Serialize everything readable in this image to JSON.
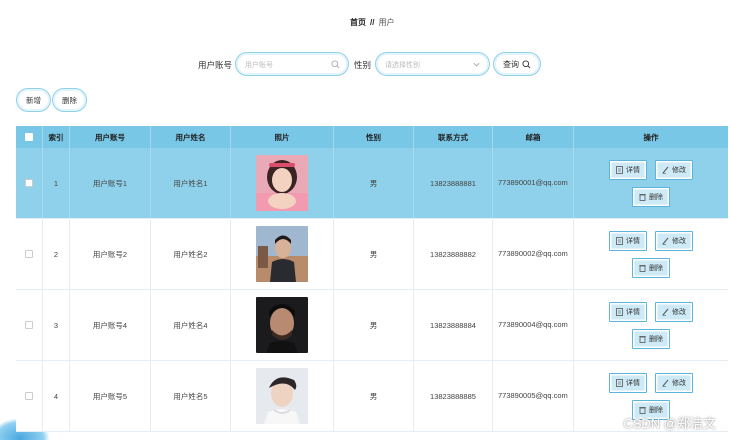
{
  "breadcrumb": {
    "home": "首页",
    "separator": "//",
    "current": "用户"
  },
  "search": {
    "account_label": "用户账号",
    "account_placeholder": "用户账号",
    "gender_label": "性别",
    "gender_placeholder": "请选择性别",
    "query_label": "查询"
  },
  "toolbar": {
    "add_label": "新增",
    "delete_label": "删除"
  },
  "table": {
    "headers": [
      "索引",
      "用户账号",
      "用户姓名",
      "照片",
      "性别",
      "联系方式",
      "邮箱",
      "操作"
    ],
    "rows": [
      {
        "index": "1",
        "account": "用户账号1",
        "name": "用户姓名1",
        "gender": "男",
        "phone": "13823888881",
        "email": "773890001@qq.com",
        "selected": true,
        "photo": "female-portrait-icon"
      },
      {
        "index": "2",
        "account": "用户账号2",
        "name": "用户姓名2",
        "gender": "男",
        "phone": "13823888882",
        "email": "773890002@qq.com",
        "selected": false,
        "photo": "male-street-portrait-icon"
      },
      {
        "index": "3",
        "account": "用户账号4",
        "name": "用户姓名4",
        "gender": "男",
        "phone": "13823888884",
        "email": "773890004@qq.com",
        "selected": false,
        "photo": "male-dark-portrait-icon"
      },
      {
        "index": "4",
        "account": "用户账号5",
        "name": "用户姓名5",
        "gender": "男",
        "phone": "13823888885",
        "email": "773890005@qq.com",
        "selected": false,
        "photo": "male-white-portrait-icon"
      }
    ],
    "row_actions": {
      "detail_label": "详情",
      "edit_label": "修改",
      "delete_label": "删除"
    }
  },
  "watermark": "CSDN @郑洁文",
  "colors": {
    "accent": "#79c7e6",
    "selected_row": "#8fd1ea",
    "button_border": "#8fd0ea"
  }
}
